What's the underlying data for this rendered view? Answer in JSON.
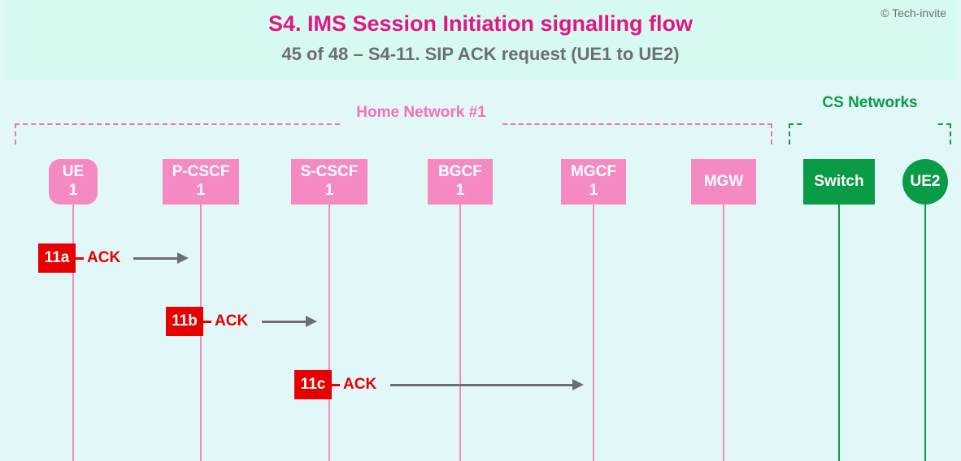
{
  "copyright": "© Tech-invite",
  "title": "S4. IMS Session Initiation signalling flow",
  "subtitle": "45 of 48 – S4-11. SIP ACK request (UE1 to UE2)",
  "lanes": {
    "home": "Home Network #1",
    "cs": "CS Networks"
  },
  "nodes": {
    "ue1": "UE\n1",
    "pcscf": "P-CSCF\n1",
    "scscf": "S-CSCF\n1",
    "bgcf": "BGCF\n1",
    "mgcf": "MGCF\n1",
    "mgw": "MGW",
    "switch": "Switch",
    "ue2": "UE2"
  },
  "messages": [
    {
      "id": "11a",
      "label": "ACK"
    },
    {
      "id": "11b",
      "label": "ACK"
    },
    {
      "id": "11c",
      "label": "ACK"
    }
  ]
}
